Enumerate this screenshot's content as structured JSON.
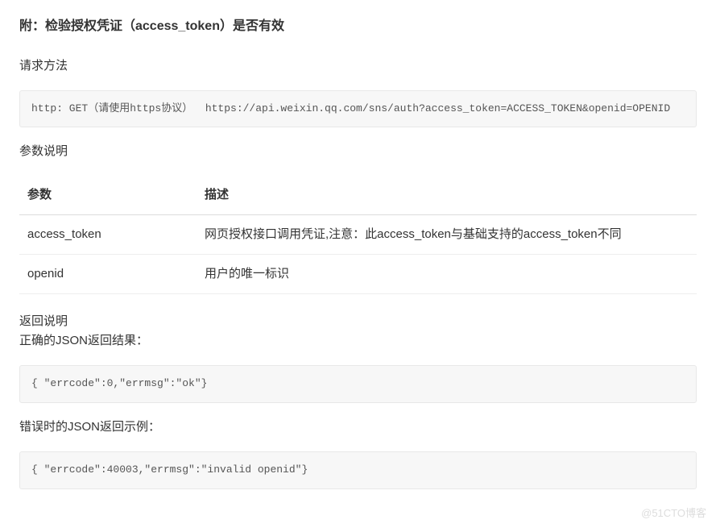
{
  "title": "附：检验授权凭证（access_token）是否有效",
  "request_method_label": "请求方法",
  "request_code": "http: GET（请使用https协议）  https://api.weixin.qq.com/sns/auth?access_token=ACCESS_TOKEN&openid=OPENID",
  "params_label": "参数说明",
  "table": {
    "headers": {
      "param": "参数",
      "desc": "描述"
    },
    "rows": [
      {
        "param": "access_token",
        "desc": "网页授权接口调用凭证,注意：此access_token与基础支持的access_token不同"
      },
      {
        "param": "openid",
        "desc": "用户的唯一标识"
      }
    ]
  },
  "return_label": "返回说明",
  "return_correct_label": "正确的JSON返回结果：",
  "return_correct_code": "{ \"errcode\":0,\"errmsg\":\"ok\"}",
  "return_error_label": "错误时的JSON返回示例：",
  "return_error_code": "{ \"errcode\":40003,\"errmsg\":\"invalid openid\"}",
  "watermark": "@51CTO博客"
}
